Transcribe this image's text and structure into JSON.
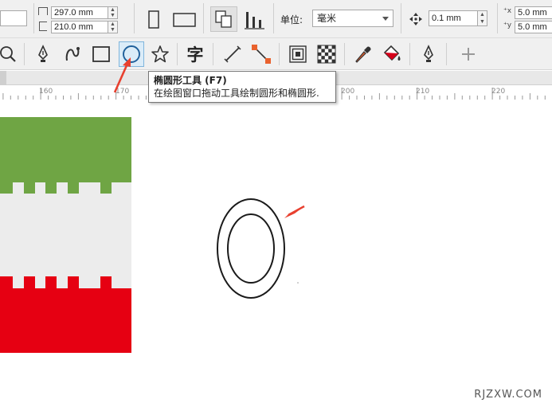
{
  "property_bar": {
    "page_width": "297.0 mm",
    "page_height": "210.0 mm",
    "units_label": "单位:",
    "units_value": "毫米",
    "nudge_value": "0.1 mm",
    "dup_x": "5.0 mm",
    "dup_y": "5.0 mm"
  },
  "toolbox": {
    "tools": [
      {
        "name": "zoom-tool",
        "icon": "magnifier-icon"
      },
      {
        "name": "pen-tool",
        "icon": "pen-nib-icon"
      },
      {
        "name": "artistic-media-tool",
        "icon": "curve-brush-icon"
      },
      {
        "name": "rectangle-tool",
        "icon": "rectangle-icon"
      },
      {
        "name": "ellipse-tool",
        "icon": "ellipse-icon",
        "active": true
      },
      {
        "name": "polygon-tool",
        "icon": "star-icon"
      },
      {
        "name": "text-tool",
        "icon": "text-icon",
        "glyph": "字"
      },
      {
        "name": "dimension-tool",
        "icon": "dimension-line-icon"
      },
      {
        "name": "connector-tool",
        "icon": "connector-icon"
      },
      {
        "name": "contour-tool",
        "icon": "contour-icon"
      },
      {
        "name": "transparency-tool",
        "icon": "checkerboard-icon"
      },
      {
        "name": "eyedropper-tool",
        "icon": "eyedropper-icon"
      },
      {
        "name": "interactive-fill-tool",
        "icon": "fill-bucket-icon"
      },
      {
        "name": "smart-fill-tool",
        "icon": "pen-outline-icon"
      },
      {
        "name": "add-tool",
        "icon": "plus-icon"
      }
    ]
  },
  "ruler": {
    "ticks": [
      "160",
      "170",
      "200",
      "210",
      "220"
    ]
  },
  "tooltip": {
    "title": "椭圆形工具 (F7)",
    "description": "在绘图窗口拖动工具绘制圆形和椭圆形."
  },
  "canvas": {
    "colors": {
      "green": "#6fa544",
      "gray": "#ececec",
      "red": "#e60012",
      "outline": "#1a1a1a",
      "arrow": "#e8402f"
    }
  },
  "watermark": "RJZXW.COM"
}
